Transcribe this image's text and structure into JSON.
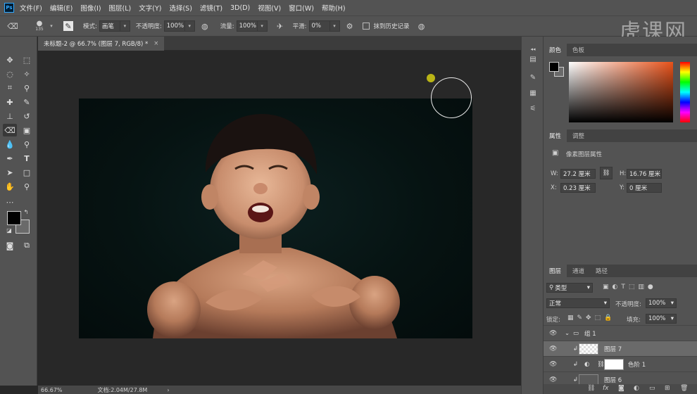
{
  "app": {
    "logo": "Ps"
  },
  "menu": [
    "文件(F)",
    "编辑(E)",
    "图像(I)",
    "图层(L)",
    "文字(Y)",
    "选择(S)",
    "滤镜(T)",
    "3D(D)",
    "视图(V)",
    "窗口(W)",
    "帮助(H)"
  ],
  "options": {
    "brush_size": "135",
    "mode_label": "模式:",
    "mode_value": "画笔",
    "opacity_label": "不透明度:",
    "opacity_value": "100%",
    "flow_label": "流量:",
    "flow_value": "100%",
    "smooth_label": "平滑:",
    "smooth_value": "0%",
    "erase_history_label": "抹到历史记录"
  },
  "watermark": "虎课网",
  "document": {
    "tab_title": "未标题-2 @ 66.7% (图层 7, RGB/8) *",
    "close": "×"
  },
  "status": {
    "zoom": "66.67%",
    "doc_info": "文档:2.04M/27.8M",
    "arrow": "›"
  },
  "color_panel": {
    "tabs": [
      "颜色",
      "色板"
    ],
    "fg": "#000000",
    "bg": "#6a6a6a"
  },
  "properties_panel": {
    "tabs": [
      "属性",
      "调整"
    ],
    "title": "像素图层属性",
    "w_label": "W:",
    "w_value": "27.2 厘米",
    "h_label": "H:",
    "h_value": "16.76 厘米",
    "x_label": "X:",
    "x_value": "0.23 厘米",
    "y_label": "Y:",
    "y_value": "0 厘米"
  },
  "layers_panel": {
    "tabs": [
      "图层",
      "通道",
      "路径"
    ],
    "filter_value": "类型",
    "blend_mode": "正常",
    "opacity_label": "不透明度:",
    "opacity_value": "100%",
    "lock_label": "锁定:",
    "fill_label": "填充:",
    "fill_value": "100%",
    "layers": [
      {
        "name": "组 1",
        "type": "group"
      },
      {
        "name": "图层 7",
        "type": "pixel",
        "selected": true
      },
      {
        "name": "色阶 1",
        "type": "adjustment"
      },
      {
        "name": "图层 6",
        "type": "pixel"
      }
    ],
    "footer_icons": [
      "link-icon",
      "fx-icon",
      "mask-icon",
      "adjustment-icon",
      "folder-icon",
      "new-layer-icon",
      "trash-icon"
    ]
  }
}
